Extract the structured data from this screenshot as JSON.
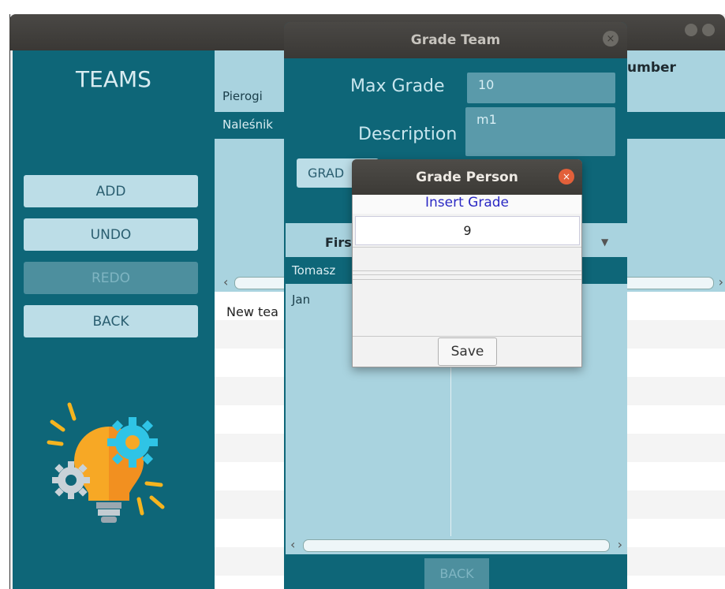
{
  "sidebar": {
    "title": "TEAMS",
    "buttons": [
      {
        "label": "ADD"
      },
      {
        "label": "UNDO"
      },
      {
        "label": "REDO"
      },
      {
        "label": "BACK"
      }
    ]
  },
  "teams_table": {
    "header_partial": "umber",
    "rows": [
      "Pierogi",
      "Naleśnik"
    ],
    "lower_row": "New tea"
  },
  "grade_team": {
    "title": "Grade Team",
    "max_grade_label": "Max Grade",
    "max_grade_value": "10",
    "description_label": "Description",
    "description_value": "m1",
    "grade_button": "GRAD",
    "column_header": "Firs",
    "people": [
      "Tomasz",
      "Jan"
    ],
    "back_button": "BACK"
  },
  "grade_person": {
    "title": "Grade Person",
    "prompt": "Insert Grade",
    "grade_value": "9",
    "save_label": "Save"
  },
  "icons": {
    "close": "×",
    "scroll_left": "‹",
    "scroll_right": "›",
    "sort_down": "▼"
  },
  "colors": {
    "teal_dark": "#0e6678",
    "teal_light": "#a9d3df",
    "button_bg": "#bcdde7",
    "prompt_text": "#2b29c4",
    "close_red": "#e2603a"
  }
}
